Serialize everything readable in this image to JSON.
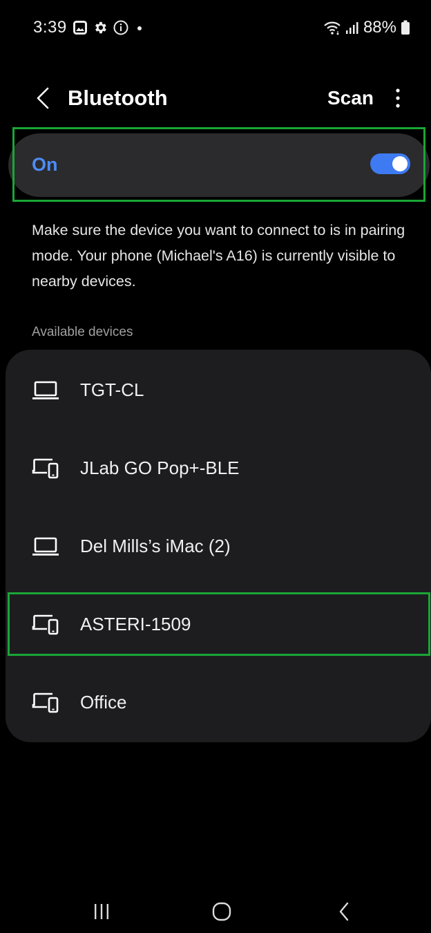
{
  "status_bar": {
    "time": "3:39",
    "battery": "88%",
    "icons_left": [
      "gallery-icon",
      "gear-icon",
      "info-icon",
      "dot-icon"
    ],
    "icons_right": [
      "wifi-icon",
      "signal-icon",
      "battery-icon"
    ]
  },
  "header": {
    "title": "Bluetooth",
    "scan_label": "Scan"
  },
  "toggle": {
    "label": "On",
    "checked": true,
    "accent_color": "#3e7bf2"
  },
  "description": "Make sure the device you want to connect to is in pairing mode. Your phone (Michael's A16) is currently visible to nearby devices.",
  "available": {
    "header": "Available devices",
    "devices": [
      {
        "name": "TGT-CL",
        "icon": "laptop-icon"
      },
      {
        "name": "JLab GO Pop+-BLE",
        "icon": "devices-icon"
      },
      {
        "name": "Del Mills’s iMac (2)",
        "icon": "laptop-icon"
      },
      {
        "name": "ASTERI-1509",
        "icon": "devices-icon"
      },
      {
        "name": "Office",
        "icon": "devices-icon"
      }
    ]
  },
  "highlight_color": "#1aa636"
}
